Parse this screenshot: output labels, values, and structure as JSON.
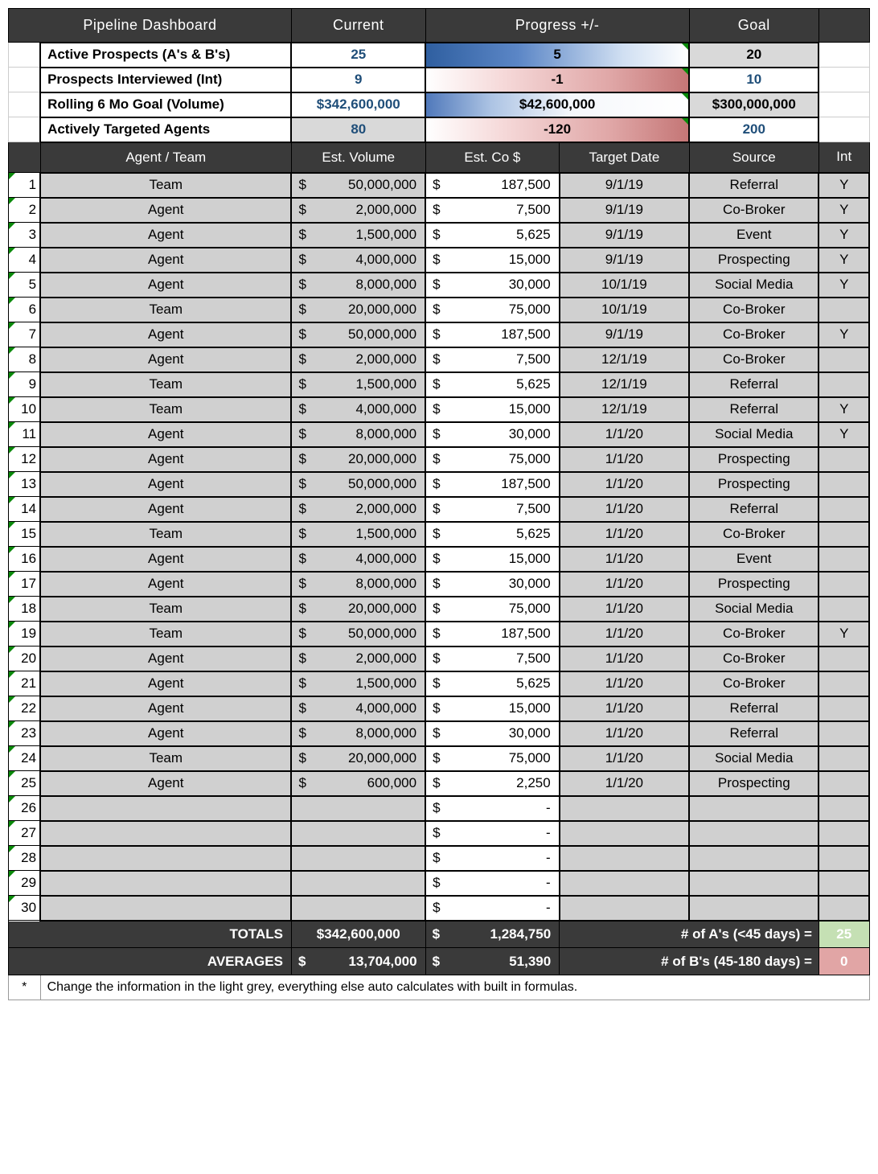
{
  "header": {
    "title": "Pipeline Dashboard",
    "current": "Current",
    "progress": "Progress +/-",
    "goal": "Goal"
  },
  "metrics": [
    {
      "label": "Active Prospects (A's & B's)",
      "current": "25",
      "progress": "5",
      "goal": "20",
      "currentGrey": false,
      "goalGrey": true,
      "grad": "grad-blue"
    },
    {
      "label": "Prospects Interviewed (Int)",
      "current": "9",
      "progress": "-1",
      "goal": "10",
      "currentGrey": false,
      "goalGrey": false,
      "grad": "grad-red"
    },
    {
      "label": "Rolling 6 Mo Goal (Volume)",
      "current": "$342,600,000",
      "progress": "$42,600,000",
      "goal": "$300,000,000",
      "currentGrey": false,
      "goalGrey": true,
      "grad": "grad-bluemid"
    },
    {
      "label": "Actively Targeted Agents",
      "current": "80",
      "progress": "-120",
      "goal": "200",
      "currentGrey": true,
      "goalGrey": false,
      "grad": "grad-red"
    }
  ],
  "columns": {
    "agent": "Agent / Team",
    "vol": "Est. Volume",
    "co": "Est. Co $",
    "date": "Target Date",
    "source": "Source",
    "int": "Int"
  },
  "rows": [
    {
      "n": "1",
      "agent": "Team",
      "vol": "50,000,000",
      "co": "187,500",
      "date": "9/1/19",
      "source": "Referral",
      "int": "Y"
    },
    {
      "n": "2",
      "agent": "Agent",
      "vol": "2,000,000",
      "co": "7,500",
      "date": "9/1/19",
      "source": "Co-Broker",
      "int": "Y"
    },
    {
      "n": "3",
      "agent": "Agent",
      "vol": "1,500,000",
      "co": "5,625",
      "date": "9/1/19",
      "source": "Event",
      "int": "Y"
    },
    {
      "n": "4",
      "agent": "Agent",
      "vol": "4,000,000",
      "co": "15,000",
      "date": "9/1/19",
      "source": "Prospecting",
      "int": "Y"
    },
    {
      "n": "5",
      "agent": "Agent",
      "vol": "8,000,000",
      "co": "30,000",
      "date": "10/1/19",
      "source": "Social Media",
      "int": "Y"
    },
    {
      "n": "6",
      "agent": "Team",
      "vol": "20,000,000",
      "co": "75,000",
      "date": "10/1/19",
      "source": "Co-Broker",
      "int": ""
    },
    {
      "n": "7",
      "agent": "Agent",
      "vol": "50,000,000",
      "co": "187,500",
      "date": "9/1/19",
      "source": "Co-Broker",
      "int": "Y"
    },
    {
      "n": "8",
      "agent": "Agent",
      "vol": "2,000,000",
      "co": "7,500",
      "date": "12/1/19",
      "source": "Co-Broker",
      "int": ""
    },
    {
      "n": "9",
      "agent": "Team",
      "vol": "1,500,000",
      "co": "5,625",
      "date": "12/1/19",
      "source": "Referral",
      "int": ""
    },
    {
      "n": "10",
      "agent": "Team",
      "vol": "4,000,000",
      "co": "15,000",
      "date": "12/1/19",
      "source": "Referral",
      "int": "Y"
    },
    {
      "n": "11",
      "agent": "Agent",
      "vol": "8,000,000",
      "co": "30,000",
      "date": "1/1/20",
      "source": "Social Media",
      "int": "Y"
    },
    {
      "n": "12",
      "agent": "Agent",
      "vol": "20,000,000",
      "co": "75,000",
      "date": "1/1/20",
      "source": "Prospecting",
      "int": ""
    },
    {
      "n": "13",
      "agent": "Agent",
      "vol": "50,000,000",
      "co": "187,500",
      "date": "1/1/20",
      "source": "Prospecting",
      "int": ""
    },
    {
      "n": "14",
      "agent": "Agent",
      "vol": "2,000,000",
      "co": "7,500",
      "date": "1/1/20",
      "source": "Referral",
      "int": ""
    },
    {
      "n": "15",
      "agent": "Team",
      "vol": "1,500,000",
      "co": "5,625",
      "date": "1/1/20",
      "source": "Co-Broker",
      "int": ""
    },
    {
      "n": "16",
      "agent": "Agent",
      "vol": "4,000,000",
      "co": "15,000",
      "date": "1/1/20",
      "source": "Event",
      "int": ""
    },
    {
      "n": "17",
      "agent": "Agent",
      "vol": "8,000,000",
      "co": "30,000",
      "date": "1/1/20",
      "source": "Prospecting",
      "int": ""
    },
    {
      "n": "18",
      "agent": "Team",
      "vol": "20,000,000",
      "co": "75,000",
      "date": "1/1/20",
      "source": "Social Media",
      "int": ""
    },
    {
      "n": "19",
      "agent": "Team",
      "vol": "50,000,000",
      "co": "187,500",
      "date": "1/1/20",
      "source": "Co-Broker",
      "int": "Y"
    },
    {
      "n": "20",
      "agent": "Agent",
      "vol": "2,000,000",
      "co": "7,500",
      "date": "1/1/20",
      "source": "Co-Broker",
      "int": ""
    },
    {
      "n": "21",
      "agent": "Agent",
      "vol": "1,500,000",
      "co": "5,625",
      "date": "1/1/20",
      "source": "Co-Broker",
      "int": ""
    },
    {
      "n": "22",
      "agent": "Agent",
      "vol": "4,000,000",
      "co": "15,000",
      "date": "1/1/20",
      "source": "Referral",
      "int": ""
    },
    {
      "n": "23",
      "agent": "Agent",
      "vol": "8,000,000",
      "co": "30,000",
      "date": "1/1/20",
      "source": "Referral",
      "int": ""
    },
    {
      "n": "24",
      "agent": "Team",
      "vol": "20,000,000",
      "co": "75,000",
      "date": "1/1/20",
      "source": "Social Media",
      "int": ""
    },
    {
      "n": "25",
      "agent": "Agent",
      "vol": "600,000",
      "co": "2,250",
      "date": "1/1/20",
      "source": "Prospecting",
      "int": ""
    },
    {
      "n": "26",
      "agent": "",
      "vol": "",
      "co": "-",
      "date": "",
      "source": "",
      "int": ""
    },
    {
      "n": "27",
      "agent": "",
      "vol": "",
      "co": "-",
      "date": "",
      "source": "",
      "int": ""
    },
    {
      "n": "28",
      "agent": "",
      "vol": "",
      "co": "-",
      "date": "",
      "source": "",
      "int": ""
    },
    {
      "n": "29",
      "agent": "",
      "vol": "",
      "co": "-",
      "date": "",
      "source": "",
      "int": ""
    },
    {
      "n": "30",
      "agent": "",
      "vol": "",
      "co": "-",
      "date": "",
      "source": "",
      "int": ""
    }
  ],
  "totals": {
    "label": "TOTALS",
    "vol": "$342,600,000",
    "co": "1,284,750",
    "a_label": "# of A's (<45 days)  =",
    "a_val": "25"
  },
  "averages": {
    "label": "AVERAGES",
    "vol": "13,704,000",
    "co": "51,390",
    "b_label": "# of B's (45-180 days)  =",
    "b_val": "0"
  },
  "footnote": {
    "star": "*",
    "text": "Change the information in the light grey, everything else auto calculates with built in formulas."
  }
}
